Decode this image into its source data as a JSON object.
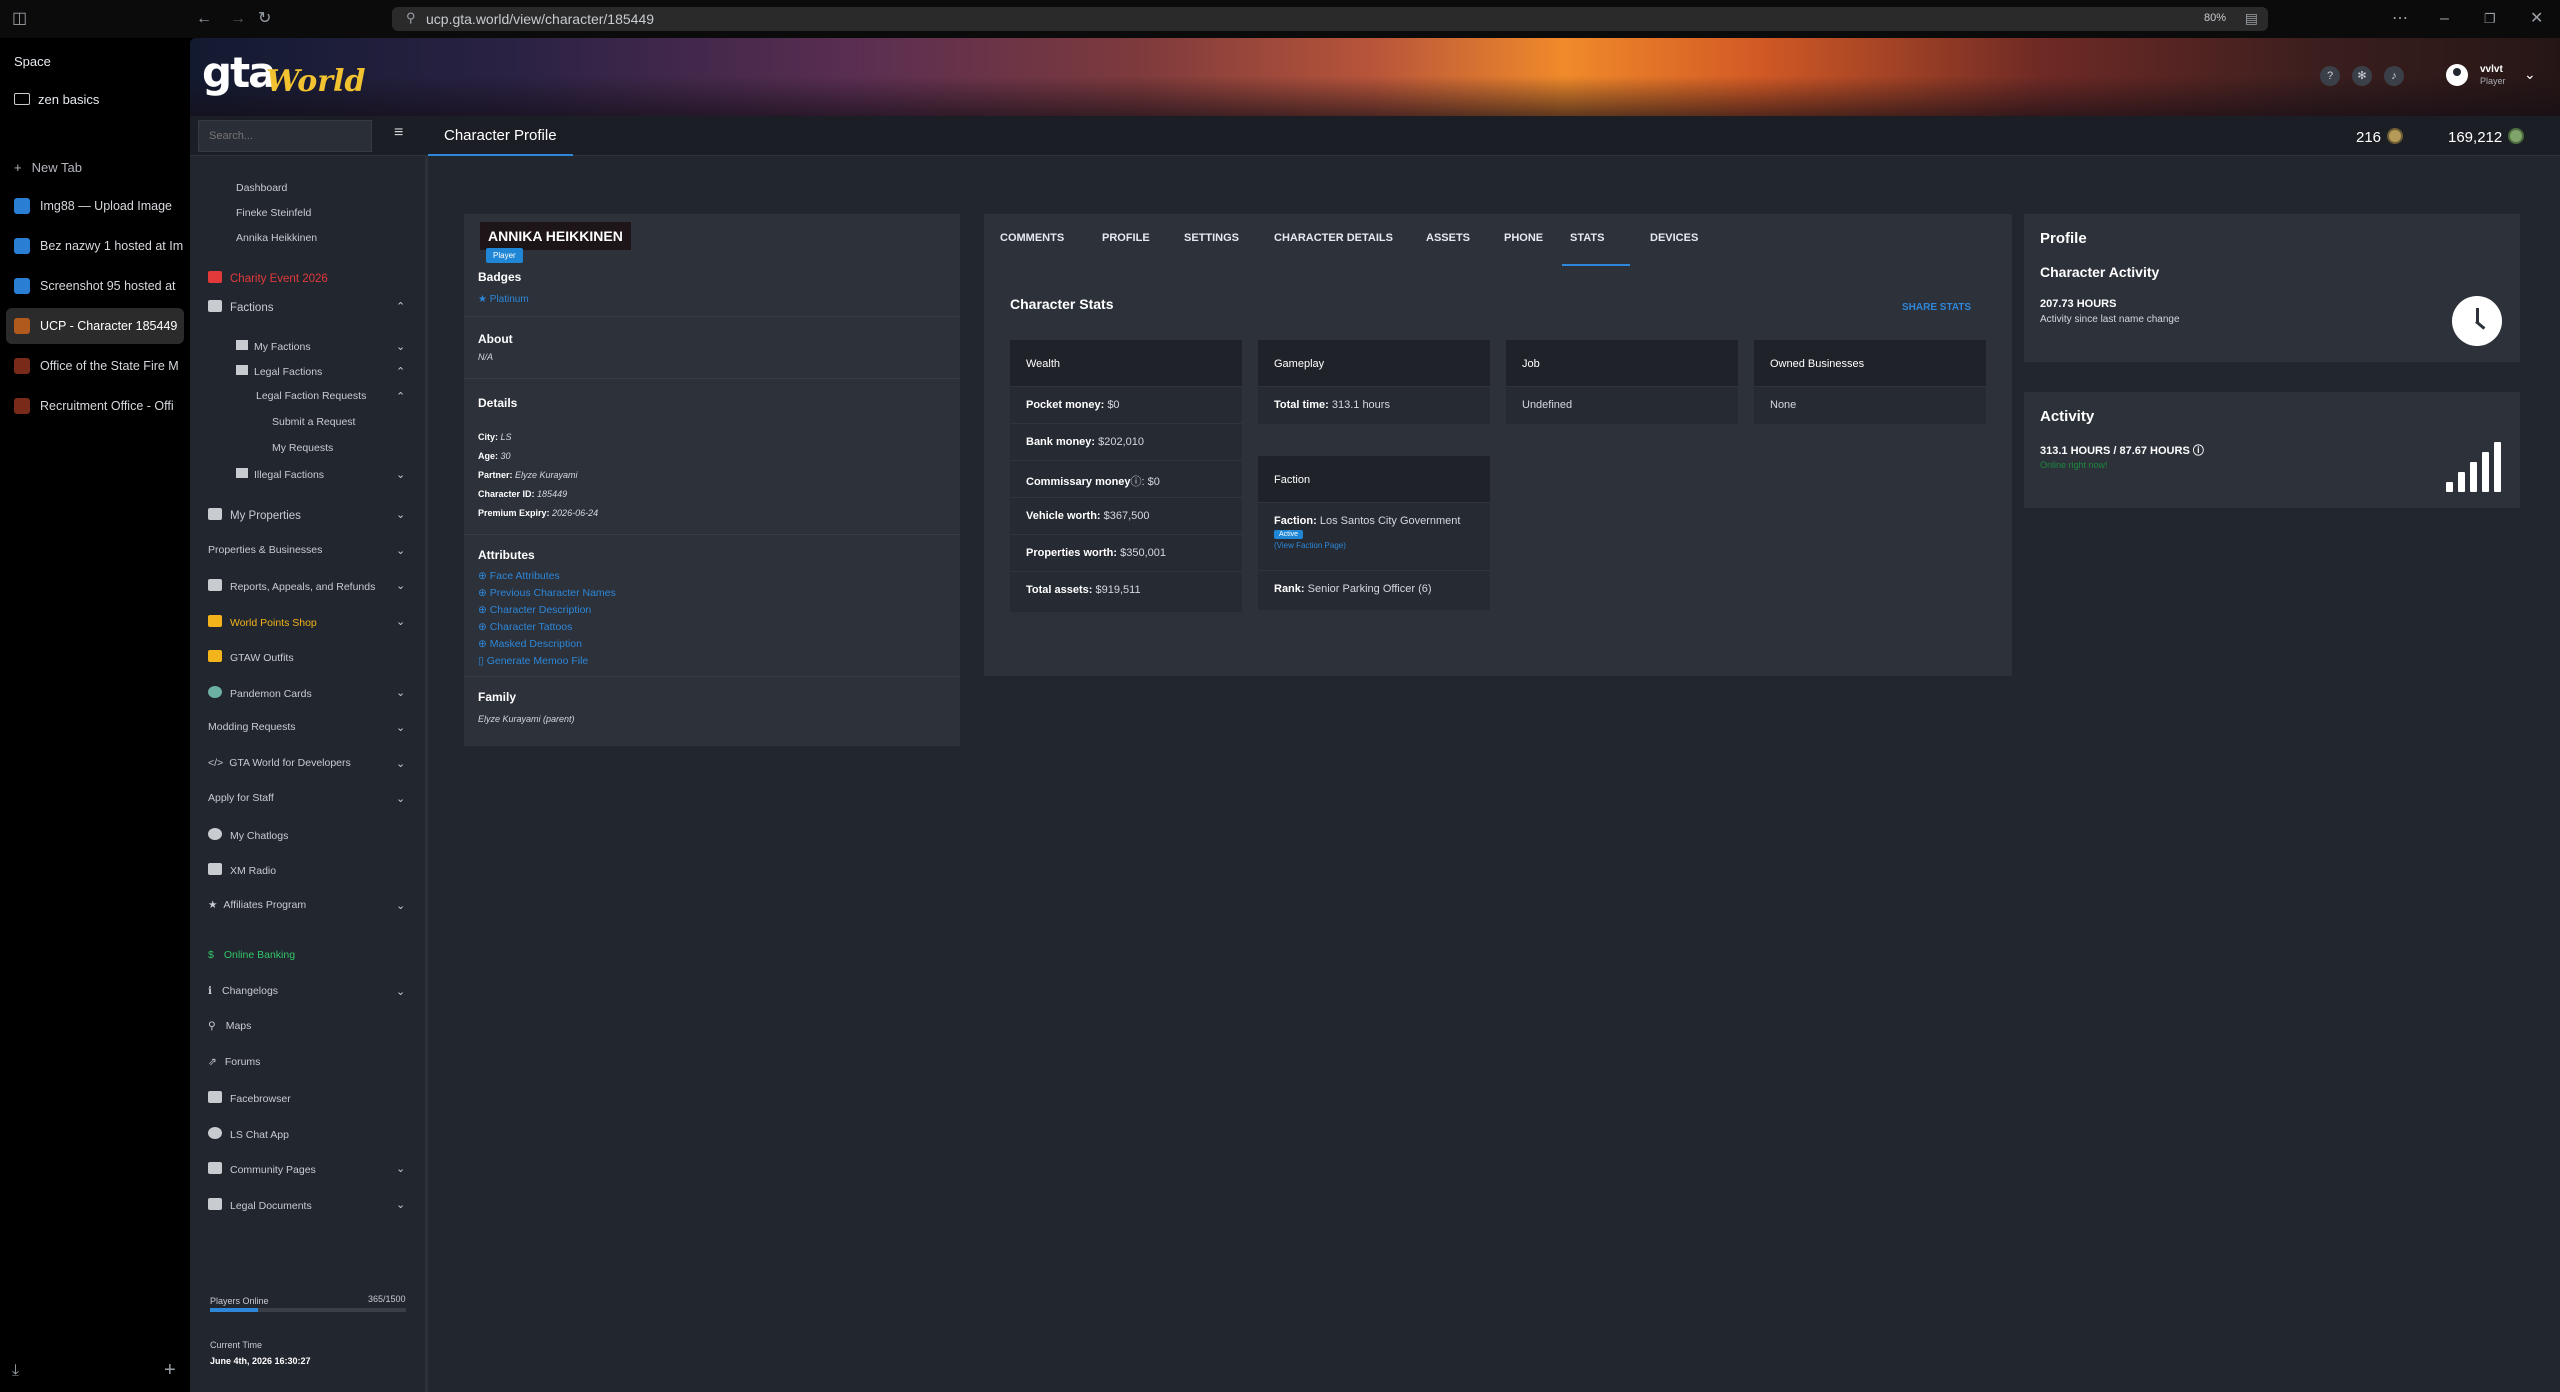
{
  "browser": {
    "url": "ucp.gta.world/view/character/185449",
    "zoom": "80%"
  },
  "zen": {
    "space": "Space",
    "folder": "zen basics",
    "new_tab": "New Tab",
    "tabs": [
      {
        "label": "Img88 — Upload Image",
        "icon": "img88-icon",
        "active": false
      },
      {
        "label": "Bez nazwy 1 hosted at Im",
        "icon": "img88-icon",
        "active": false
      },
      {
        "label": "Screenshot 95 hosted at",
        "icon": "img88-icon",
        "active": false
      },
      {
        "label": "UCP - Character 185449",
        "icon": "gtaw-icon",
        "active": true
      },
      {
        "label": "Office of the State Fire M",
        "icon": "fire-marshal-icon",
        "active": false
      },
      {
        "label": "Recruitment Office - Offi",
        "icon": "fire-marshal-icon",
        "active": false
      }
    ]
  },
  "header": {
    "logo": "gta",
    "logo_sub": "World",
    "user_name": "vvlvt",
    "user_role": "Player"
  },
  "subbar": {
    "search_placeholder": "Search...",
    "page_title": "Character Profile",
    "stat_a": "216",
    "stat_b": "169,212"
  },
  "nav": {
    "dashboard": "Dashboard",
    "fineke": "Fineke Steinfeld",
    "annika": "Annika Heikkinen",
    "charity": "Charity Event 2026",
    "factions": "Factions",
    "my_factions": "My Factions",
    "legal_factions": "Legal Factions",
    "legal_requests": "Legal Faction Requests",
    "submit_request": "Submit a Request",
    "my_requests": "My Requests",
    "illegal_factions": "Illegal Factions",
    "my_properties": "My Properties",
    "properties_businesses": "Properties & Businesses",
    "reports": "Reports, Appeals, and Refunds",
    "world_points": "World Points Shop",
    "gtaw_outfits": "GTAW Outfits",
    "pandemon": "Pandemon Cards",
    "modding": "Modding Requests",
    "developers": "GTA World for Developers",
    "apply_staff": "Apply for Staff",
    "chatlogs": "My Chatlogs",
    "xm_radio": "XM Radio",
    "affiliates": "Affiliates Program",
    "online_banking": "Online Banking",
    "changelogs": "Changelogs",
    "maps": "Maps",
    "forums": "Forums",
    "facebrowser": "Facebrowser",
    "ls_chat": "LS Chat App",
    "community": "Community Pages",
    "legal_docs": "Legal Documents",
    "players_online_label": "Players Online",
    "players_online_value": "365/1500",
    "players_online_fraction": 0.243,
    "current_time_label": "Current Time",
    "current_time_value": "June 4th, 2026 16:30:27"
  },
  "character": {
    "name": "ANNIKA HEIKKINEN",
    "role": "Player",
    "badges_title": "Badges",
    "badge": "Platinum",
    "about_title": "About",
    "about_text": "N/A",
    "details_title": "Details",
    "city_label": "City:",
    "city": "LS",
    "age_label": "Age:",
    "age": "30",
    "partner_label": "Partner:",
    "partner": "Elyze Kurayami",
    "id_label": "Character ID:",
    "id": "185449",
    "premium_label": "Premium Expiry:",
    "premium": "2026-06-24",
    "attributes_title": "Attributes",
    "attributes": [
      "Face Attributes",
      "Previous Character Names",
      "Character Description",
      "Character Tattoos",
      "Masked Description",
      "Generate Memoo File"
    ],
    "family_title": "Family",
    "family": "Elyze Kurayami (parent)"
  },
  "tabs": [
    "COMMENTS",
    "PROFILE",
    "SETTINGS",
    "CHARACTER DETAILS",
    "ASSETS",
    "PHONE",
    "STATS",
    "DEVICES"
  ],
  "stats": {
    "title": "Character Stats",
    "share": "SHARE STATS",
    "wealth_head": "Wealth",
    "pocket_label": "Pocket money:",
    "pocket": "$0",
    "bank_label": "Bank money:",
    "bank": "$202,010",
    "commissary_label": "Commissary money",
    "commissary": "$0",
    "vehicle_label": "Vehicle worth:",
    "vehicle": "$367,500",
    "properties_label": "Properties worth:",
    "properties": "$350,001",
    "total_label": "Total assets:",
    "total": "$919,511",
    "gameplay_head": "Gameplay",
    "time_label": "Total time:",
    "time": "313.1 hours",
    "job_head": "Job",
    "job": "Undefined",
    "biz_head": "Owned Businesses",
    "biz": "None",
    "faction_head": "Faction",
    "faction_label": "Faction:",
    "faction": "Los Santos City Government",
    "faction_status": "Active",
    "faction_link": "(View Faction Page)",
    "rank_label": "Rank:",
    "rank": "Senior Parking Officer (6)"
  },
  "profile_card": {
    "title": "Profile",
    "activity_title": "Character Activity",
    "hours": "207.73 HOURS",
    "since": "Activity since last name change"
  },
  "activity_card": {
    "title": "Activity",
    "hours": "313.1 HOURS / 87.67 HOURS",
    "online": "Online right now!"
  }
}
